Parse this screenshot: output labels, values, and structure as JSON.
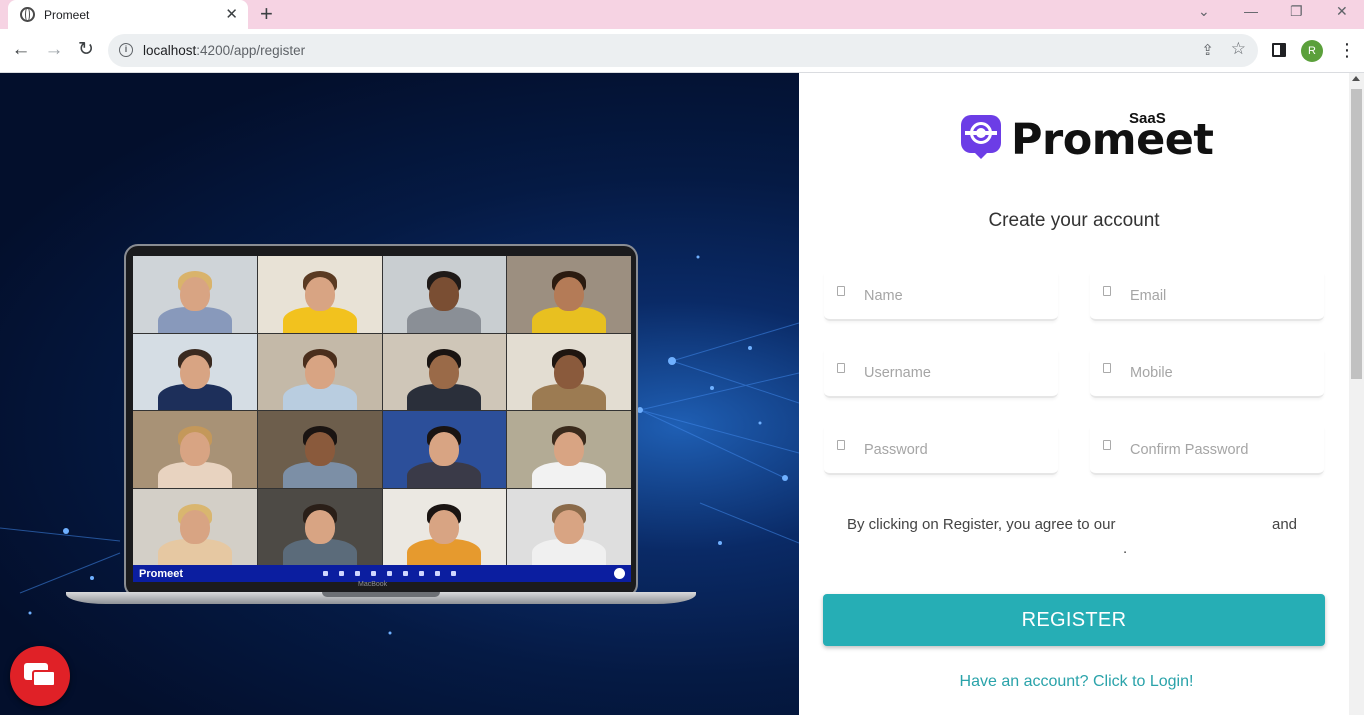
{
  "browser": {
    "tab_title": "Promeet",
    "tab_close": "✕",
    "new_tab": "+",
    "url_host": "localhost",
    "url_rest": ":4200/app/register",
    "profile_initial": "R",
    "window_controls": {
      "dropdown": "⌄",
      "minimize": "—",
      "restore": "❐",
      "close": "✕"
    },
    "nav": {
      "back": "←",
      "forward": "→",
      "reload": "↻"
    }
  },
  "hero": {
    "meeting_app_name": "Promeet",
    "laptop_label": "MacBook",
    "participants": 16
  },
  "brand": {
    "name": "Promeet",
    "badge": "SaaS",
    "accent_color": "#6c3de6",
    "primary_color": "#26aeb5"
  },
  "form": {
    "heading": "Create your account",
    "fields": {
      "name": "Name",
      "email": "Email",
      "username": "Username",
      "mobile": "Mobile",
      "password": "Password",
      "confirm_password": "Confirm Password"
    },
    "terms_prefix": "By clicking on Register, you agree to our",
    "terms_and": "and",
    "terms_end": ".",
    "register_label": "REGISTER",
    "login_link": "Have an account? Click to Login!"
  }
}
